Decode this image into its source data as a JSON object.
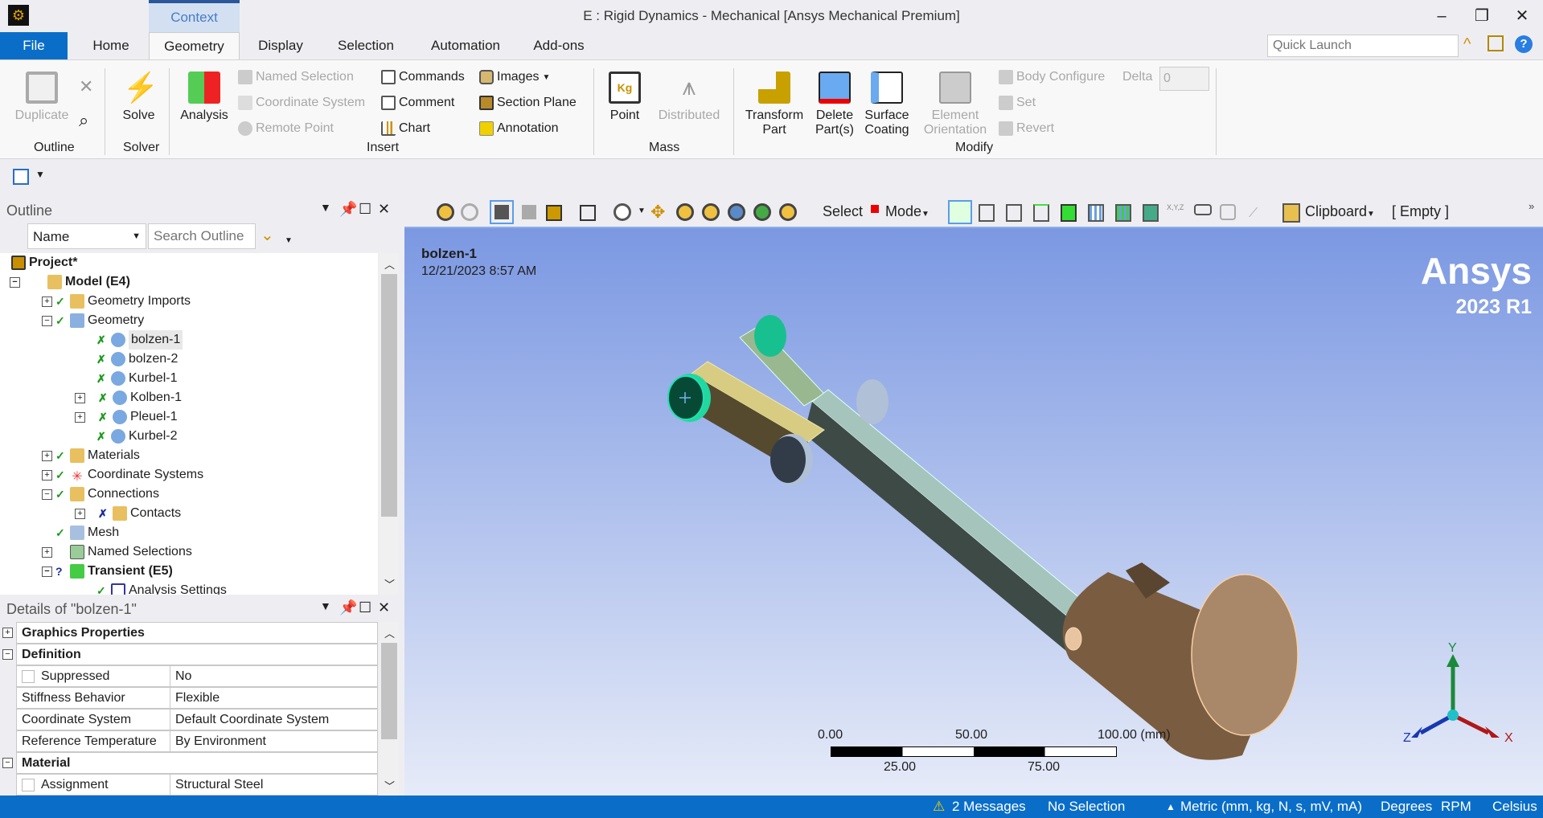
{
  "title": "E : Rigid Dynamics - Mechanical [Ansys Mechanical Premium]",
  "context_tab": "Context",
  "tabs": [
    "File",
    "Home",
    "Geometry",
    "Display",
    "Selection",
    "Automation",
    "Add-ons"
  ],
  "quick_launch_placeholder": "Quick Launch",
  "ribbon": {
    "outline": {
      "duplicate": "Duplicate",
      "group": "Outline"
    },
    "solver": {
      "solve": "Solve",
      "group": "Solver"
    },
    "insert": {
      "analysis": "Analysis",
      "named_selection": "Named Selection",
      "coordinate_system": "Coordinate System",
      "remote_point": "Remote Point",
      "commands": "Commands",
      "comment": "Comment",
      "chart": "Chart",
      "images": "Images",
      "section_plane": "Section Plane",
      "annotation": "Annotation",
      "group": "Insert"
    },
    "mass": {
      "point": "Point",
      "distributed": "Distributed",
      "group": "Mass"
    },
    "modify": {
      "transform1": "Transform",
      "transform2": "Part",
      "delete1": "Delete",
      "delete2": "Part(s)",
      "surface1": "Surface",
      "surface2": "Coating",
      "element1": "Element",
      "element2": "Orientation",
      "body_configure": "Body Configure",
      "delta_label": "Delta",
      "delta_value": "0",
      "set": "Set",
      "revert": "Revert",
      "group": "Modify"
    }
  },
  "outline": {
    "title": "Outline",
    "filter": "Name",
    "search_placeholder": "Search Outline",
    "tree": [
      {
        "label": "Project*"
      },
      {
        "label": "Model (E4)"
      },
      {
        "label": "Geometry Imports"
      },
      {
        "label": "Geometry"
      },
      {
        "label": "bolzen-1"
      },
      {
        "label": "bolzen-2"
      },
      {
        "label": "Kurbel-1"
      },
      {
        "label": "Kolben-1"
      },
      {
        "label": "Pleuel-1"
      },
      {
        "label": "Kurbel-2"
      },
      {
        "label": "Materials"
      },
      {
        "label": "Coordinate Systems"
      },
      {
        "label": "Connections"
      },
      {
        "label": "Contacts"
      },
      {
        "label": "Mesh"
      },
      {
        "label": "Named Selections"
      },
      {
        "label": "Transient (E5)"
      },
      {
        "label": "Analysis Settings"
      }
    ]
  },
  "details": {
    "title": "Details of \"bolzen-1\"",
    "rows": [
      {
        "name": "Graphics Properties"
      },
      {
        "name": "Definition"
      },
      {
        "name": "Suppressed",
        "value": "No"
      },
      {
        "name": "Stiffness Behavior",
        "value": "Flexible"
      },
      {
        "name": "Coordinate System",
        "value": "Default Coordinate System"
      },
      {
        "name": "Reference Temperature",
        "value": "By Environment"
      },
      {
        "name": "Material"
      },
      {
        "name": "Assignment",
        "value": "Structural Steel"
      }
    ]
  },
  "graphics_toolbar": {
    "select": "Select",
    "mode": "Mode",
    "clipboard": "Clipboard",
    "clipboard_state": "[ Empty ]",
    "xyz": "X,Y,Z"
  },
  "viewport": {
    "object_name": "bolzen-1",
    "timestamp": "12/21/2023 8:57 AM",
    "brand": "Ansys",
    "version": "2023 R1",
    "scale": {
      "top": [
        "0.00",
        "50.00",
        "100.00 (mm)"
      ],
      "bottom": [
        "25.00",
        "75.00"
      ]
    },
    "axes": {
      "x": "X",
      "y": "Y",
      "z": "Z"
    }
  },
  "status": {
    "messages": "2 Messages",
    "selection": "No Selection",
    "units": "Metric (mm, kg, N, s, mV, mA)",
    "angle": "Degrees",
    "speed": "RPM",
    "temperature": "Celsius"
  }
}
